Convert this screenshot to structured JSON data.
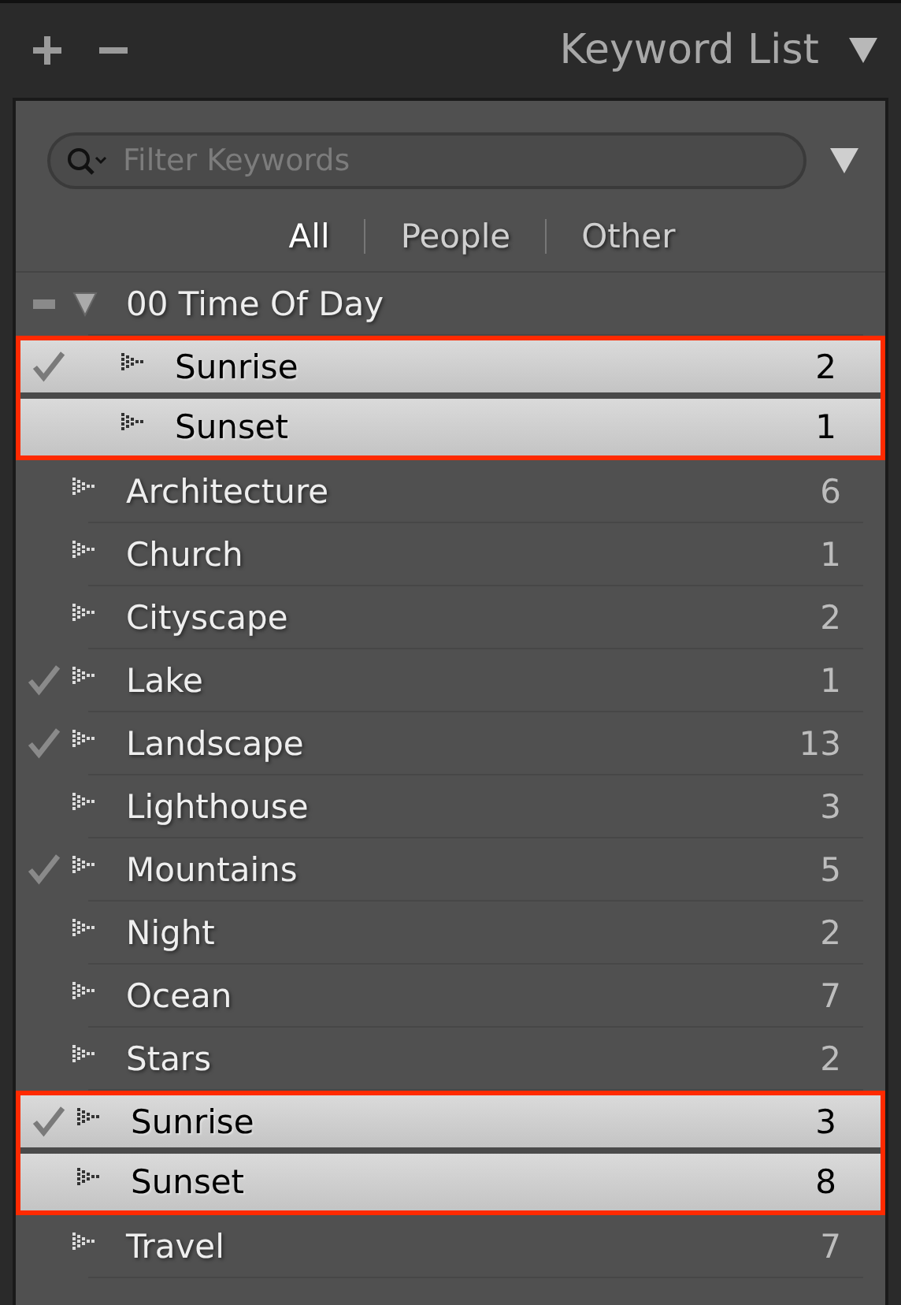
{
  "panel": {
    "title": "Keyword List"
  },
  "filter": {
    "placeholder": "Filter Keywords"
  },
  "tabs": [
    {
      "label": "All",
      "selected": true
    },
    {
      "label": "People",
      "selected": false
    },
    {
      "label": "Other",
      "selected": false
    }
  ],
  "keywords": [
    {
      "name": "00 Time Of Day",
      "checked": false,
      "mixed": true,
      "selected": false,
      "outlined": false,
      "expanded": true,
      "children": [
        {
          "name": "Sunrise",
          "count": "2",
          "checked": true,
          "mixed": false,
          "selected": true,
          "outlined": true
        },
        {
          "name": "Sunset",
          "count": "1",
          "checked": false,
          "mixed": false,
          "selected": true,
          "outlined": true
        }
      ]
    },
    {
      "name": "Architecture",
      "count": "6",
      "checked": false,
      "mixed": false,
      "selected": false,
      "outlined": false
    },
    {
      "name": "Church",
      "count": "1",
      "checked": false,
      "mixed": false,
      "selected": false,
      "outlined": false
    },
    {
      "name": "Cityscape",
      "count": "2",
      "checked": false,
      "mixed": false,
      "selected": false,
      "outlined": false
    },
    {
      "name": "Lake",
      "count": "1",
      "checked": true,
      "mixed": false,
      "selected": false,
      "outlined": false
    },
    {
      "name": "Landscape",
      "count": "13",
      "checked": true,
      "mixed": false,
      "selected": false,
      "outlined": false
    },
    {
      "name": "Lighthouse",
      "count": "3",
      "checked": false,
      "mixed": false,
      "selected": false,
      "outlined": false
    },
    {
      "name": "Mountains",
      "count": "5",
      "checked": true,
      "mixed": false,
      "selected": false,
      "outlined": false
    },
    {
      "name": "Night",
      "count": "2",
      "checked": false,
      "mixed": false,
      "selected": false,
      "outlined": false
    },
    {
      "name": "Ocean",
      "count": "7",
      "checked": false,
      "mixed": false,
      "selected": false,
      "outlined": false
    },
    {
      "name": "Stars",
      "count": "2",
      "checked": false,
      "mixed": false,
      "selected": false,
      "outlined": false
    },
    {
      "name": "Sunrise",
      "count": "3",
      "checked": true,
      "mixed": false,
      "selected": true,
      "outlined": true
    },
    {
      "name": "Sunset",
      "count": "8",
      "checked": false,
      "mixed": false,
      "selected": true,
      "outlined": true
    },
    {
      "name": "Travel",
      "count": "7",
      "checked": false,
      "mixed": false,
      "selected": false,
      "outlined": false
    }
  ]
}
